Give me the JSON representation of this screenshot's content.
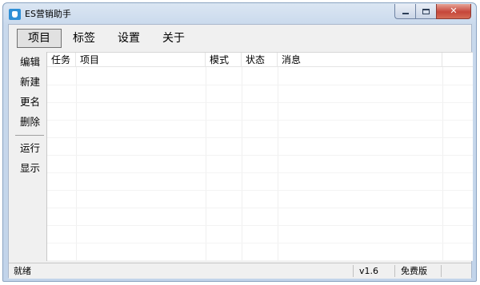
{
  "window": {
    "title": "ES营销助手"
  },
  "menubar": {
    "tabs": [
      "项目",
      "标签",
      "设置",
      "关于"
    ],
    "active": "项目"
  },
  "sidebar": {
    "group1": [
      "编辑",
      "新建",
      "更名",
      "删除"
    ],
    "group2": [
      "运行",
      "显示"
    ]
  },
  "list": {
    "columns": [
      "任务",
      "项目",
      "模式",
      "状态",
      "消息"
    ],
    "rows": []
  },
  "statusbar": {
    "status": "就绪",
    "version": "v1.6",
    "edition": "免费版"
  },
  "colors": {
    "title_bar": "#c9d9ec",
    "close_button": "#c6463a",
    "client_bg": "#f0f0f0"
  },
  "icons": {
    "app": "es-app-icon",
    "minimize": "minimize-icon",
    "maximize": "maximize-icon",
    "close": "close-icon"
  }
}
